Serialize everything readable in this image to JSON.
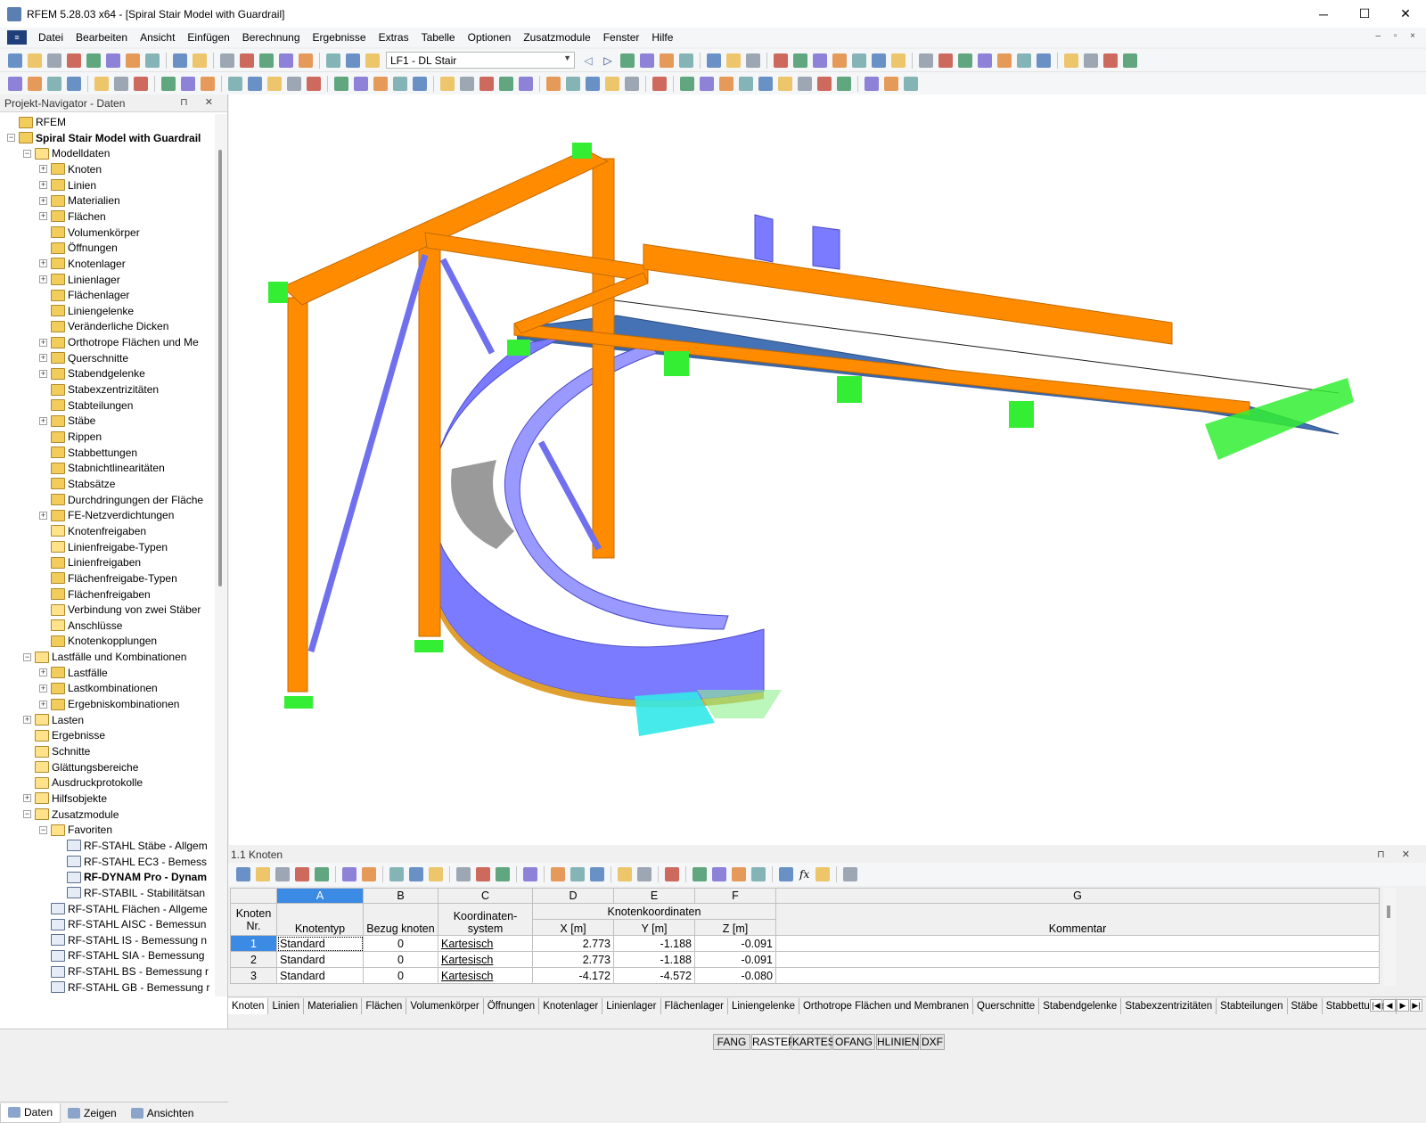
{
  "app": {
    "title": "RFEM 5.28.03 x64 - [Spiral Stair Model with Guardrail]",
    "window_controls": [
      "─",
      "☐",
      "✕"
    ],
    "mdi_controls": "‒ ▫ ×"
  },
  "menu": [
    "Datei",
    "Bearbeiten",
    "Ansicht",
    "Einfügen",
    "Berechnung",
    "Ergebnisse",
    "Extras",
    "Tabelle",
    "Optionen",
    "Zusatzmodule",
    "Fenster",
    "Hilfe"
  ],
  "toolbar": {
    "loadcase": "LF1 - DL Stair",
    "icon_colors": [
      "#3b6fb6",
      "#e9b43b",
      "#7d8c9c",
      "#c0392b",
      "#2e8b57",
      "#6a5acd",
      "#e07b24",
      "#5f9ea0"
    ]
  },
  "navigator": {
    "title": "Projekt-Navigator - Daten",
    "controls": "⊓ ✕",
    "tree": [
      {
        "label": "RFEM",
        "level": 0,
        "expander": "none",
        "icon": "rfem-root-icon",
        "bold": false
      },
      {
        "label": "Spiral Stair Model with Guardrail",
        "level": 0,
        "expander": "minus",
        "icon": "model-icon",
        "bold": true
      },
      {
        "label": "Modelldaten",
        "level": 1,
        "expander": "minus",
        "icon": "folder-icon",
        "bold": false
      },
      {
        "label": "Knoten",
        "level": 2,
        "expander": "plus",
        "icon": "nodes-folder-icon",
        "bold": false
      },
      {
        "label": "Linien",
        "level": 2,
        "expander": "plus",
        "icon": "lines-folder-icon",
        "bold": false
      },
      {
        "label": "Materialien",
        "level": 2,
        "expander": "plus",
        "icon": "materials-folder-icon",
        "bold": false
      },
      {
        "label": "Flächen",
        "level": 2,
        "expander": "plus",
        "icon": "surfaces-folder-icon",
        "bold": false
      },
      {
        "label": "Volumenkörper",
        "level": 2,
        "expander": "none",
        "icon": "solids-folder-icon",
        "bold": false
      },
      {
        "label": "Öffnungen",
        "level": 2,
        "expander": "none",
        "icon": "openings-folder-icon",
        "bold": false
      },
      {
        "label": "Knotenlager",
        "level": 2,
        "expander": "plus",
        "icon": "nodal-supports-folder-icon",
        "bold": false
      },
      {
        "label": "Linienlager",
        "level": 2,
        "expander": "plus",
        "icon": "line-supports-folder-icon",
        "bold": false
      },
      {
        "label": "Flächenlager",
        "level": 2,
        "expander": "none",
        "icon": "surface-supports-folder-icon",
        "bold": false
      },
      {
        "label": "Liniengelenke",
        "level": 2,
        "expander": "none",
        "icon": "line-hinges-folder-icon",
        "bold": false
      },
      {
        "label": "Veränderliche Dicken",
        "level": 2,
        "expander": "none",
        "icon": "variable-thickness-folder-icon",
        "bold": false
      },
      {
        "label": "Orthotrope Flächen und Me",
        "level": 2,
        "expander": "plus",
        "icon": "orthotropic-folder-icon",
        "bold": false
      },
      {
        "label": "Querschnitte",
        "level": 2,
        "expander": "plus",
        "icon": "cross-sections-folder-icon",
        "bold": false
      },
      {
        "label": "Stabendgelenke",
        "level": 2,
        "expander": "plus",
        "icon": "member-hinges-folder-icon",
        "bold": false
      },
      {
        "label": "Stabexzentrizitäten",
        "level": 2,
        "expander": "none",
        "icon": "eccentricities-folder-icon",
        "bold": false
      },
      {
        "label": "Stabteilungen",
        "level": 2,
        "expander": "none",
        "icon": "divisions-folder-icon",
        "bold": false
      },
      {
        "label": "Stäbe",
        "level": 2,
        "expander": "plus",
        "icon": "members-folder-icon",
        "bold": false
      },
      {
        "label": "Rippen",
        "level": 2,
        "expander": "none",
        "icon": "ribs-folder-icon",
        "bold": false
      },
      {
        "label": "Stabbettungen",
        "level": 2,
        "expander": "none",
        "icon": "elastic-foundations-folder-icon",
        "bold": false
      },
      {
        "label": "Stabnichtlinearitäten",
        "level": 2,
        "expander": "none",
        "icon": "nonlinearities-folder-icon",
        "bold": false
      },
      {
        "label": "Stabsätze",
        "level": 2,
        "expander": "none",
        "icon": "sets-of-members-folder-icon",
        "bold": false
      },
      {
        "label": "Durchdringungen der Fläche",
        "level": 2,
        "expander": "none",
        "icon": "intersections-folder-icon",
        "bold": false
      },
      {
        "label": "FE-Netzverdichtungen",
        "level": 2,
        "expander": "plus",
        "icon": "fe-mesh-folder-icon",
        "bold": false
      },
      {
        "label": "Knotenfreigaben",
        "level": 2,
        "expander": "none",
        "icon": "folder-icon",
        "bold": false
      },
      {
        "label": "Linienfreigabe-Typen",
        "level": 2,
        "expander": "none",
        "icon": "folder-icon",
        "bold": false
      },
      {
        "label": "Linienfreigaben",
        "level": 2,
        "expander": "none",
        "icon": "line-releases-folder-icon",
        "bold": false
      },
      {
        "label": "Flächenfreigabe-Typen",
        "level": 2,
        "expander": "none",
        "icon": "surface-release-types-folder-icon",
        "bold": false
      },
      {
        "label": "Flächenfreigaben",
        "level": 2,
        "expander": "none",
        "icon": "surface-releases-folder-icon",
        "bold": false
      },
      {
        "label": "Verbindung von zwei Stäber",
        "level": 2,
        "expander": "none",
        "icon": "folder-icon",
        "bold": false
      },
      {
        "label": "Anschlüsse",
        "level": 2,
        "expander": "none",
        "icon": "folder-icon",
        "bold": false
      },
      {
        "label": "Knotenkopplungen",
        "level": 2,
        "expander": "none",
        "icon": "node-couplings-folder-icon",
        "bold": false
      },
      {
        "label": "Lastfälle und Kombinationen",
        "level": 1,
        "expander": "minus",
        "icon": "folder-icon",
        "bold": false
      },
      {
        "label": "Lastfälle",
        "level": 2,
        "expander": "plus",
        "icon": "load-cases-icon",
        "bold": false
      },
      {
        "label": "Lastkombinationen",
        "level": 2,
        "expander": "plus",
        "icon": "load-combinations-icon",
        "bold": false
      },
      {
        "label": "Ergebniskombinationen",
        "level": 2,
        "expander": "plus",
        "icon": "result-combinations-icon",
        "bold": false
      },
      {
        "label": "Lasten",
        "level": 1,
        "expander": "plus",
        "icon": "folder-icon",
        "bold": false
      },
      {
        "label": "Ergebnisse",
        "level": 1,
        "expander": "none",
        "icon": "folder-icon",
        "bold": false
      },
      {
        "label": "Schnitte",
        "level": 1,
        "expander": "none",
        "icon": "folder-icon",
        "bold": false
      },
      {
        "label": "Glättungsbereiche",
        "level": 1,
        "expander": "none",
        "icon": "folder-icon",
        "bold": false
      },
      {
        "label": "Ausdruckprotokolle",
        "level": 1,
        "expander": "none",
        "icon": "folder-icon",
        "bold": false
      },
      {
        "label": "Hilfsobjekte",
        "level": 1,
        "expander": "plus",
        "icon": "folder-icon",
        "bold": false
      },
      {
        "label": "Zusatzmodule",
        "level": 1,
        "expander": "minus",
        "icon": "folder-icon",
        "bold": false
      },
      {
        "label": "Favoriten",
        "level": 2,
        "expander": "minus",
        "icon": "folder-icon",
        "bold": false
      },
      {
        "label": "RF-STAHL Stäbe - Allgem",
        "level": 3,
        "expander": "none",
        "icon": "module-icon",
        "bold": false
      },
      {
        "label": "RF-STAHL EC3 - Bemess",
        "level": 3,
        "expander": "none",
        "icon": "module-icon",
        "bold": false
      },
      {
        "label": "RF-DYNAM Pro - Dynam",
        "level": 3,
        "expander": "none",
        "icon": "module-icon",
        "bold": true
      },
      {
        "label": "RF-STABIL - Stabilitätsan",
        "level": 3,
        "expander": "none",
        "icon": "module-icon",
        "bold": false
      },
      {
        "label": "RF-STAHL Flächen - Allgeme",
        "level": 2,
        "expander": "none",
        "icon": "module-icon",
        "bold": false
      },
      {
        "label": "RF-STAHL AISC - Bemessun",
        "level": 2,
        "expander": "none",
        "icon": "module-icon",
        "bold": false
      },
      {
        "label": "RF-STAHL IS - Bemessung n",
        "level": 2,
        "expander": "none",
        "icon": "module-icon",
        "bold": false
      },
      {
        "label": "RF-STAHL SIA - Bemessung",
        "level": 2,
        "expander": "none",
        "icon": "module-icon",
        "bold": false
      },
      {
        "label": "RF-STAHL BS - Bemessung r",
        "level": 2,
        "expander": "none",
        "icon": "module-icon",
        "bold": false
      },
      {
        "label": "RF-STAHL GB - Bemessung r",
        "level": 2,
        "expander": "none",
        "icon": "module-icon",
        "bold": false
      }
    ],
    "tabs": [
      {
        "label": "Daten",
        "icon": "data-tab-icon"
      },
      {
        "label": "Zeigen",
        "icon": "display-tab-icon"
      },
      {
        "label": "Ansichten",
        "icon": "views-tab-icon"
      }
    ]
  },
  "viewport": {
    "colors": {
      "member": "#ff8c00",
      "member_dark": "#d86a00",
      "stair_surface": "#7b7bff",
      "slab": "#4472b4",
      "support": "#33ee33",
      "spring": "#33e8e8"
    }
  },
  "table": {
    "title": "1.1 Knoten",
    "controls": "⊓ ✕",
    "column_letters": [
      "A",
      "B",
      "C",
      "D",
      "E",
      "F",
      "G"
    ],
    "header": {
      "node_no": "Knoten Nr.",
      "node_type": "Knotentyp",
      "ref_node": "Bezug knoten",
      "coord_system": "Koordinaten-system",
      "coords_group": "Knotenkoordinaten",
      "x": "X [m]",
      "y": "Y [m]",
      "z": "Z [m]",
      "comment": "Kommentar"
    },
    "rows": [
      {
        "no": "1",
        "type": "Standard",
        "ref": "0",
        "system": "Kartesisch",
        "x": "2.773",
        "y": "-1.188",
        "z": "-0.091",
        "comment": ""
      },
      {
        "no": "2",
        "type": "Standard",
        "ref": "0",
        "system": "Kartesisch",
        "x": "2.773",
        "y": "-1.188",
        "z": "-0.091",
        "comment": ""
      },
      {
        "no": "3",
        "type": "Standard",
        "ref": "0",
        "system": "Kartesisch",
        "x": "-4.172",
        "y": "-4.572",
        "z": "-0.080",
        "comment": ""
      }
    ],
    "sheet_tabs": [
      "Knoten",
      "Linien",
      "Materialien",
      "Flächen",
      "Volumenkörper",
      "Öffnungen",
      "Knotenlager",
      "Linienlager",
      "Flächenlager",
      "Liniengelenke",
      "Orthotrope Flächen und Membranen",
      "Querschnitte",
      "Stabendgelenke",
      "Stabexzentrizitäten",
      "Stabteilungen",
      "Stäbe",
      "Stabbettungen"
    ],
    "tab_nav": [
      "|◀",
      "◀",
      "▶",
      "▶|"
    ],
    "fx_label": "fx"
  },
  "statusbar": {
    "buttons": [
      "FANG",
      "RASTER",
      "KARTES",
      "OFANG",
      "HLINIEN",
      "DXF"
    ]
  }
}
